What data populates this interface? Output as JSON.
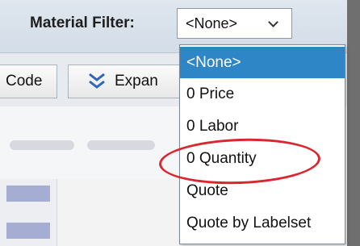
{
  "toolbar": {
    "material_filter_label": "Material Filter:",
    "material_filter_value": "<None>",
    "code_button_label": "Code",
    "expand_button_label": "Expan"
  },
  "dropdown": {
    "options": [
      {
        "label": "<None>",
        "selected": true
      },
      {
        "label": "0 Price"
      },
      {
        "label": "0 Labor"
      },
      {
        "label": "0 Quantity",
        "highlighted": true
      },
      {
        "label": "Quote"
      },
      {
        "label": "Quote by Labelset"
      }
    ]
  },
  "colors": {
    "selected_bg": "#2f86c6",
    "highlight_circle": "#d9272f"
  },
  "icons": {
    "filter_chevron": "chevron-down-icon",
    "expand_icon": "double-chevron-down-icon"
  }
}
